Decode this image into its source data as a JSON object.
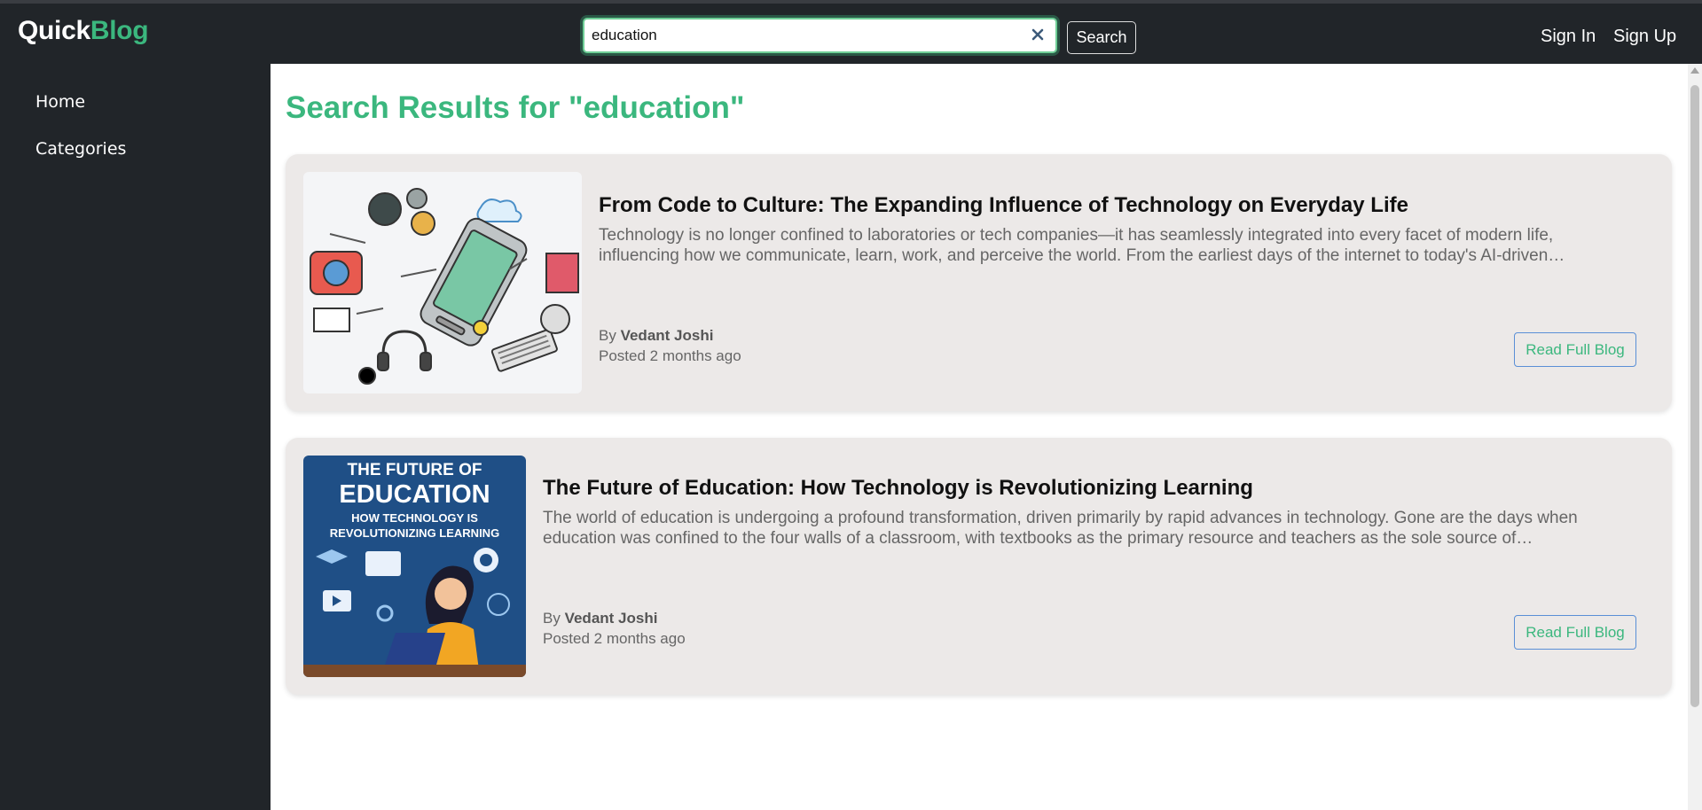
{
  "brand": {
    "part1": "Quick",
    "part2": "Blog"
  },
  "search": {
    "value": "education",
    "button_label": "Search"
  },
  "nav": {
    "sign_in": "Sign In",
    "sign_up": "Sign Up"
  },
  "sidebar": {
    "items": [
      {
        "label": "Home"
      },
      {
        "label": "Categories"
      }
    ]
  },
  "results": {
    "title": "Search Results for \"education\"",
    "posts": [
      {
        "title": "From Code to Culture: The Expanding Influence of Technology on Everyday Life",
        "excerpt": "Technology is no longer confined to laboratories or tech companies—it has seamlessly integrated into every facet of modern life, influencing how we communicate, learn, work, and perceive the world. From the earliest days of the internet to today's AI-driven…",
        "by_label": "By",
        "author": "Vedant Joshi",
        "posted": "Posted 2 months ago",
        "button": "Read Full Blog"
      },
      {
        "title": "The Future of Education: How Technology is Revolutionizing Learning",
        "excerpt": "The world of education is undergoing a profound transformation, driven primarily by rapid advances in technology. Gone are the days when education was confined to the four walls of a classroom, with textbooks as the primary resource and teachers as the sole source of…",
        "by_label": "By",
        "author": "Vedant Joshi",
        "posted": "Posted 2 months ago",
        "button": "Read Full Blog",
        "image_text": {
          "line1": "THE FUTURE OF",
          "line2": "EDUCATION",
          "line3": "HOW TECHNOLOGY IS",
          "line4": "REVOLUTIONIZING LEARNING"
        }
      }
    ]
  },
  "colors": {
    "accent": "#3bb77e",
    "nav_bg": "#212529",
    "card_bg": "#ece9e8",
    "button_border": "#5a8fd6"
  }
}
